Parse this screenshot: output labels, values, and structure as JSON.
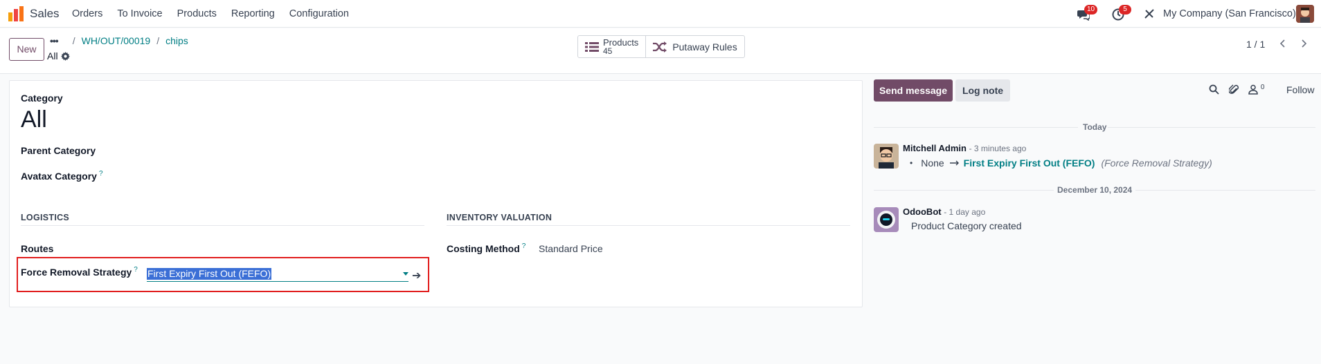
{
  "navbar": {
    "app_name": "Sales",
    "menu": [
      "Orders",
      "To Invoice",
      "Products",
      "Reporting",
      "Configuration"
    ],
    "messages_count": "10",
    "activities_count": "5",
    "company": "My Company (San Francisco)"
  },
  "control": {
    "new_label": "New",
    "breadcrumb_dots": "•••",
    "breadcrumbs": [
      "WH/OUT/00019",
      "chips"
    ],
    "record_name": "All",
    "smart_products_label": "Products",
    "smart_products_value": "45",
    "smart_putaway_label": "Putaway Rules",
    "pager": "1 / 1"
  },
  "form": {
    "category_label": "Category",
    "category_value": "All",
    "parent_category_label": "Parent Category",
    "avatax_label": "Avatax Category",
    "help_mark": "?",
    "logistics_title": "LOGISTICS",
    "valuation_title": "INVENTORY VALUATION",
    "routes_label": "Routes",
    "removal_label": "Force Removal Strategy",
    "removal_value": "First Expiry First Out (FEFO)",
    "costing_label": "Costing Method",
    "costing_value": "Standard Price"
  },
  "chatter": {
    "send_label": "Send message",
    "log_label": "Log note",
    "followers_count": "0",
    "follow_label": "Follow",
    "date_today": "Today",
    "msg1_author": "Mitchell Admin",
    "msg1_when": "- 3 minutes ago",
    "msg1_old": "None",
    "msg1_new": "First Expiry First Out (FEFO)",
    "msg1_field": "(Force Removal Strategy)",
    "date_2": "December 10, 2024",
    "msg2_author": "OdooBot",
    "msg2_when": "- 1 day ago",
    "msg2_body": "Product Category created"
  },
  "colors": {
    "brand": "#714b67",
    "link": "#017e84",
    "highlight": "#e11d1d",
    "selection": "#3b6fd6"
  }
}
